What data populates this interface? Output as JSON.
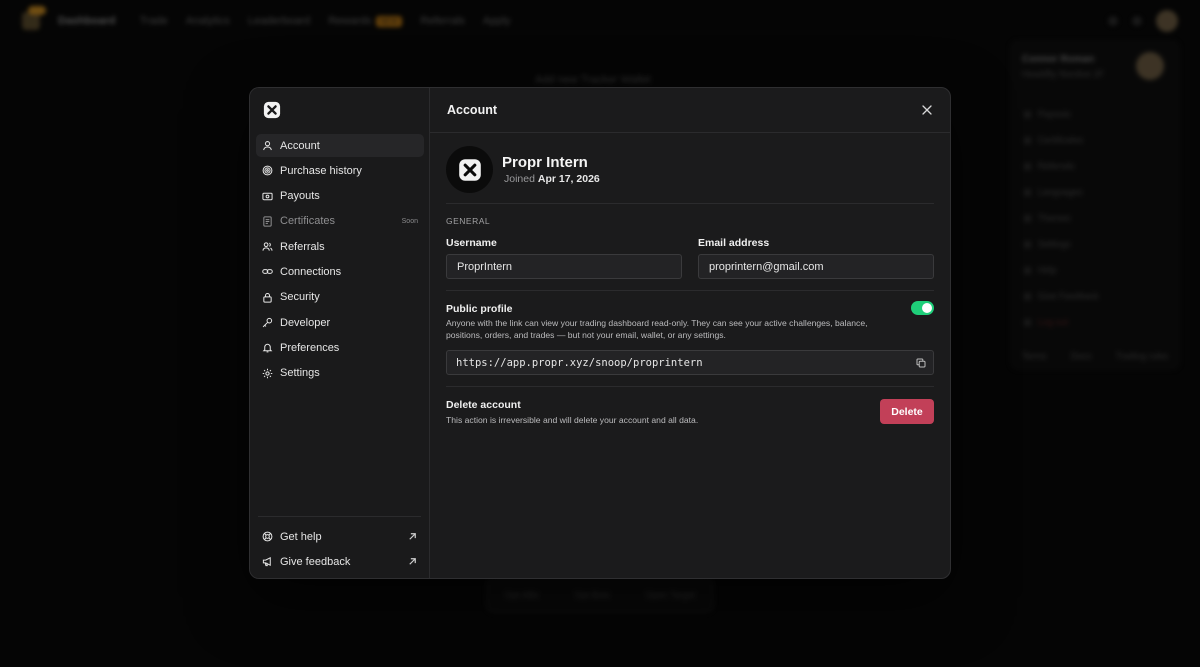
{
  "background": {
    "brand": "Dashboard",
    "nav": [
      "Trade",
      "Analytics",
      "Leaderboard",
      "Rewards",
      "Referrals",
      "Apply"
    ],
    "rewards_badge": "NEW",
    "center_title": "Add new Tracker Wallet",
    "bottom_tabs": [
      "Opt-ABs",
      "Opt-Bets",
      "Open Target"
    ],
    "panel": {
      "name": "Connor Roman",
      "sub": "Head/By Nombre 2F",
      "items": [
        "Payouts",
        "Certificates",
        "Referrals",
        "Languages",
        "Themes",
        "Settings",
        "Help",
        "Give Feedback"
      ],
      "logout": "Log out",
      "footer": [
        "Terms",
        "Docs",
        "Trading rules"
      ]
    }
  },
  "modal": {
    "sidebar": {
      "items": [
        {
          "label": "Account",
          "icon": "user-icon",
          "active": true
        },
        {
          "label": "Purchase history",
          "icon": "target-icon"
        },
        {
          "label": "Payouts",
          "icon": "banknote-icon"
        },
        {
          "label": "Certificates",
          "icon": "document-icon",
          "badge": "Soon",
          "disabled": true
        },
        {
          "label": "Referrals",
          "icon": "users-icon"
        },
        {
          "label": "Connections",
          "icon": "link-icon"
        },
        {
          "label": "Security",
          "icon": "lock-icon"
        },
        {
          "label": "Developer",
          "icon": "key-icon"
        },
        {
          "label": "Preferences",
          "icon": "bell-icon"
        },
        {
          "label": "Settings",
          "icon": "gear-icon"
        }
      ],
      "bottom": [
        {
          "label": "Get help",
          "icon": "lifebuoy-icon"
        },
        {
          "label": "Give feedback",
          "icon": "megaphone-icon"
        }
      ]
    },
    "title": "Account",
    "profile": {
      "name": "Propr Intern",
      "joined_prefix": "Joined",
      "joined_date": "Apr 17, 2026"
    },
    "general_label": "GENERAL",
    "username_label": "Username",
    "username_value": "ProprIntern",
    "email_label": "Email address",
    "email_value": "proprintern@gmail.com",
    "public_profile": {
      "title": "Public profile",
      "description": "Anyone with the link can view your trading dashboard read-only. They can see your active challenges, balance, positions, orders, and trades — but not your email, wallet, or any settings.",
      "enabled": true,
      "url": "https://app.propr.xyz/snoop/proprintern"
    },
    "delete": {
      "title": "Delete account",
      "description": "This action is irreversible and will delete your account and all data.",
      "button": "Delete"
    }
  },
  "colors": {
    "toggle_on": "#1fcf7a",
    "danger": "#c24058",
    "modal_bg": "#1b1b1c"
  }
}
